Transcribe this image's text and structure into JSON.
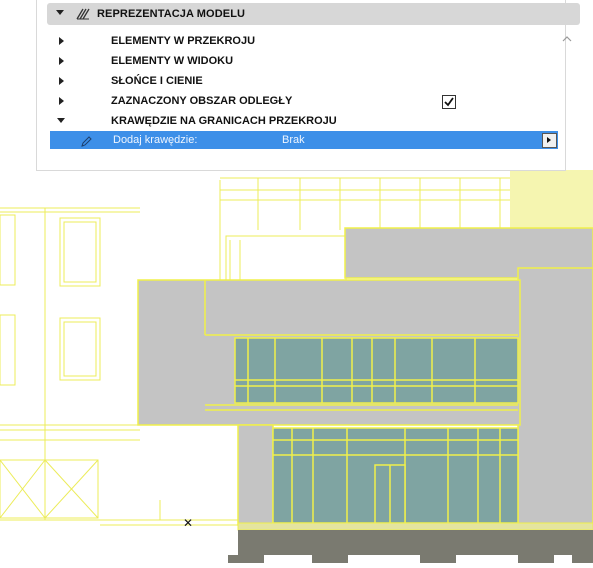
{
  "panel": {
    "header_title": "REPREZENTACJA MODELU",
    "header_icon": "section-representation-icon",
    "rows": [
      {
        "label": "ELEMENTY W PRZEKROJU",
        "expanded": false
      },
      {
        "label": "ELEMENTY W WIDOKU",
        "expanded": false
      },
      {
        "label": "SŁOŃCE I CIENIE",
        "expanded": false
      },
      {
        "label": "ZAZNACZONY OBSZAR ODLEGŁY",
        "expanded": false,
        "checked": true
      },
      {
        "label": "KRAWĘDZIE NA GRANICACH PRZEKROJU",
        "expanded": true
      }
    ],
    "selected_row": {
      "key": "Dodaj krawędzie:",
      "value": "Brak",
      "icon": "pencil-icon",
      "highlight": "#3d8fe8"
    }
  },
  "drawing": {
    "line_color": "#f0f04a",
    "glass_color": "#7fa4a2",
    "wall_color": "#c4c4c4",
    "base_color": "#7a7a70",
    "bg_tint": "#f6f6b4"
  }
}
